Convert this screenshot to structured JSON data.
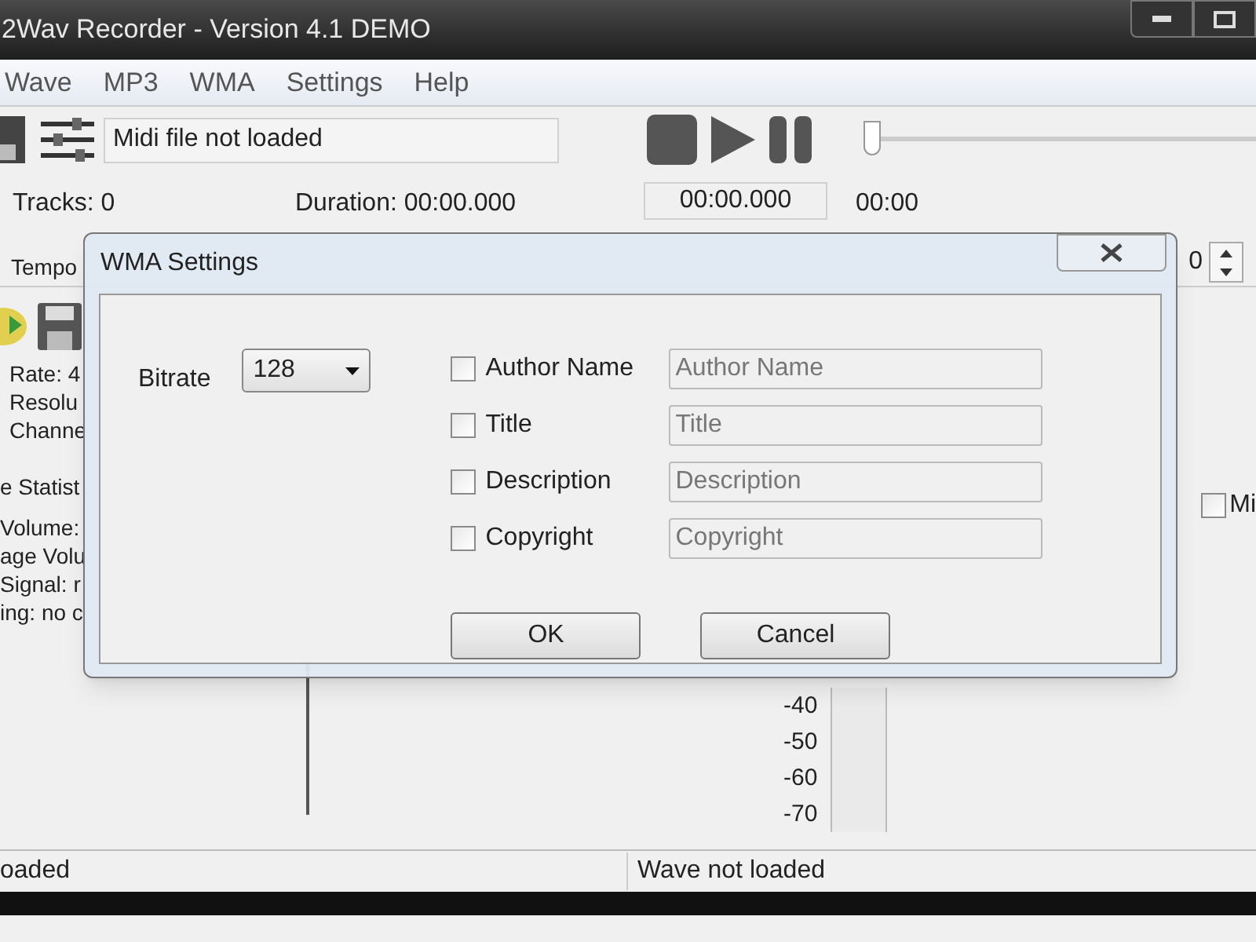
{
  "window": {
    "title": "2Wav Recorder - Version 4.1 DEMO"
  },
  "menu": [
    "Wave",
    "MP3",
    "WMA",
    "Settings",
    "Help"
  ],
  "toolbar": {
    "midi_status": "Midi file not loaded",
    "position_slider": {
      "level": 0
    }
  },
  "info": {
    "tracks": "Tracks: 0",
    "duration": "Duration: 00:00.000",
    "tempo": "Tempo",
    "time": "00:00.000",
    "time_short": "00:00",
    "spinner_value": "0"
  },
  "left_panel": {
    "lines": [
      "Rate: 4",
      "Resolu",
      "Channe",
      "e Statist",
      "Volume:",
      "age Volu",
      "Signal: r",
      "ing: no c"
    ]
  },
  "meter": {
    "scale": [
      "-40",
      "-50",
      "-60",
      "-70"
    ]
  },
  "mic_checkbox": {
    "label": "Mi",
    "checked": false
  },
  "status_bar": [
    "oaded",
    "Wave not loaded"
  ],
  "dialog": {
    "title": "WMA Settings",
    "bitrate": {
      "label": "Bitrate",
      "value": "128"
    },
    "tags": [
      {
        "label": "Author Name",
        "checked": false,
        "placeholder": "Author Name"
      },
      {
        "label": "Title",
        "checked": false,
        "placeholder": "Title"
      },
      {
        "label": "Description",
        "checked": false,
        "placeholder": "Description"
      },
      {
        "label": "Copyright",
        "checked": false,
        "placeholder": "Copyright"
      }
    ],
    "buttons": [
      "OK",
      "Cancel"
    ]
  }
}
